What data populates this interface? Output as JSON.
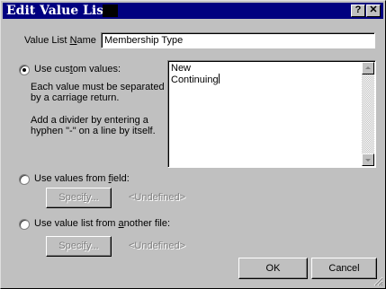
{
  "window": {
    "title": "Edit Value List",
    "help_label": "?",
    "close_label": "✕"
  },
  "name_field": {
    "label_prefix": "Value List ",
    "label_mnemonic": "N",
    "label_suffix": "ame",
    "value": "Membership Type"
  },
  "custom": {
    "label_prefix": "Use cus",
    "label_mnemonic": "t",
    "label_suffix": "om values:",
    "selected": true,
    "help1_line1": "Each value must be separated",
    "help1_line2": "by a carriage return.",
    "help2_line1": "Add a divider by entering a",
    "help2_line2": "hyphen \"-\" on a line by itself.",
    "values": [
      "New",
      "Continuing"
    ]
  },
  "field_option": {
    "label_prefix": "Use values from ",
    "label_mnemonic": "f",
    "label_suffix": "ield:",
    "selected": false,
    "specify_prefix": "Speci",
    "specify_mnemonic": "f",
    "specify_suffix": "y...",
    "undefined_text": "<Undefined>"
  },
  "file_option": {
    "label_prefix": "Use value list from ",
    "label_mnemonic": "a",
    "label_suffix": "nother file:",
    "selected": false,
    "specify_prefix": "Speci",
    "specify_mnemonic": "f",
    "specify_suffix": "y...",
    "undefined_text": "<Undefined>"
  },
  "buttons": {
    "ok": "OK",
    "cancel": "Cancel"
  }
}
